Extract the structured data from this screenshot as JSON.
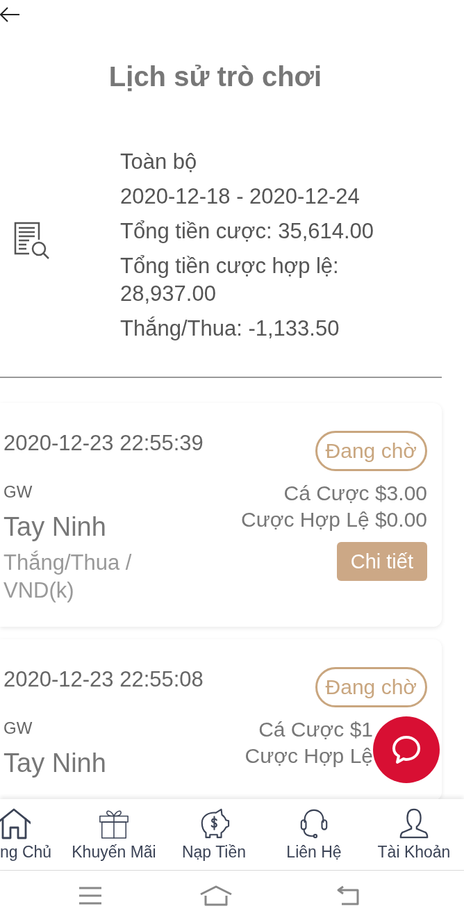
{
  "title": "Lịch sử trò chơi",
  "summary": {
    "lines": [
      "Toàn bộ",
      "2020-12-18 - 2020-12-24",
      "Tổng tiền cược: 35,614.00",
      "Tổng tiền cược hợp lệ: 28,937.00",
      "Thắng/Thua: -1,133.50"
    ]
  },
  "bets": [
    {
      "time": "2020-12-23 22:55:39",
      "status": "Đang chờ",
      "provider": "GW",
      "game": "Tay Ninh",
      "bet_amount": "Cá Cược $3.00",
      "valid_amount": "Cược Hợp Lệ $0.00",
      "result": "Thắng/Thua / VND(k)",
      "detail_button": "Chi tiết"
    },
    {
      "time": "2020-12-23 22:55:08",
      "status": "Đang chờ",
      "provider": "GW",
      "game": "Tay Ninh",
      "bet_amount": "Cá Cược $1",
      "valid_amount": "Cược Hợp Lệ"
    }
  ],
  "bottom_nav": [
    {
      "label": "ng Chủ"
    },
    {
      "label": "Khuyến Mãi"
    },
    {
      "label": "Nạp Tiền"
    },
    {
      "label": "Liên Hệ"
    },
    {
      "label": "Tài Khoản"
    }
  ]
}
